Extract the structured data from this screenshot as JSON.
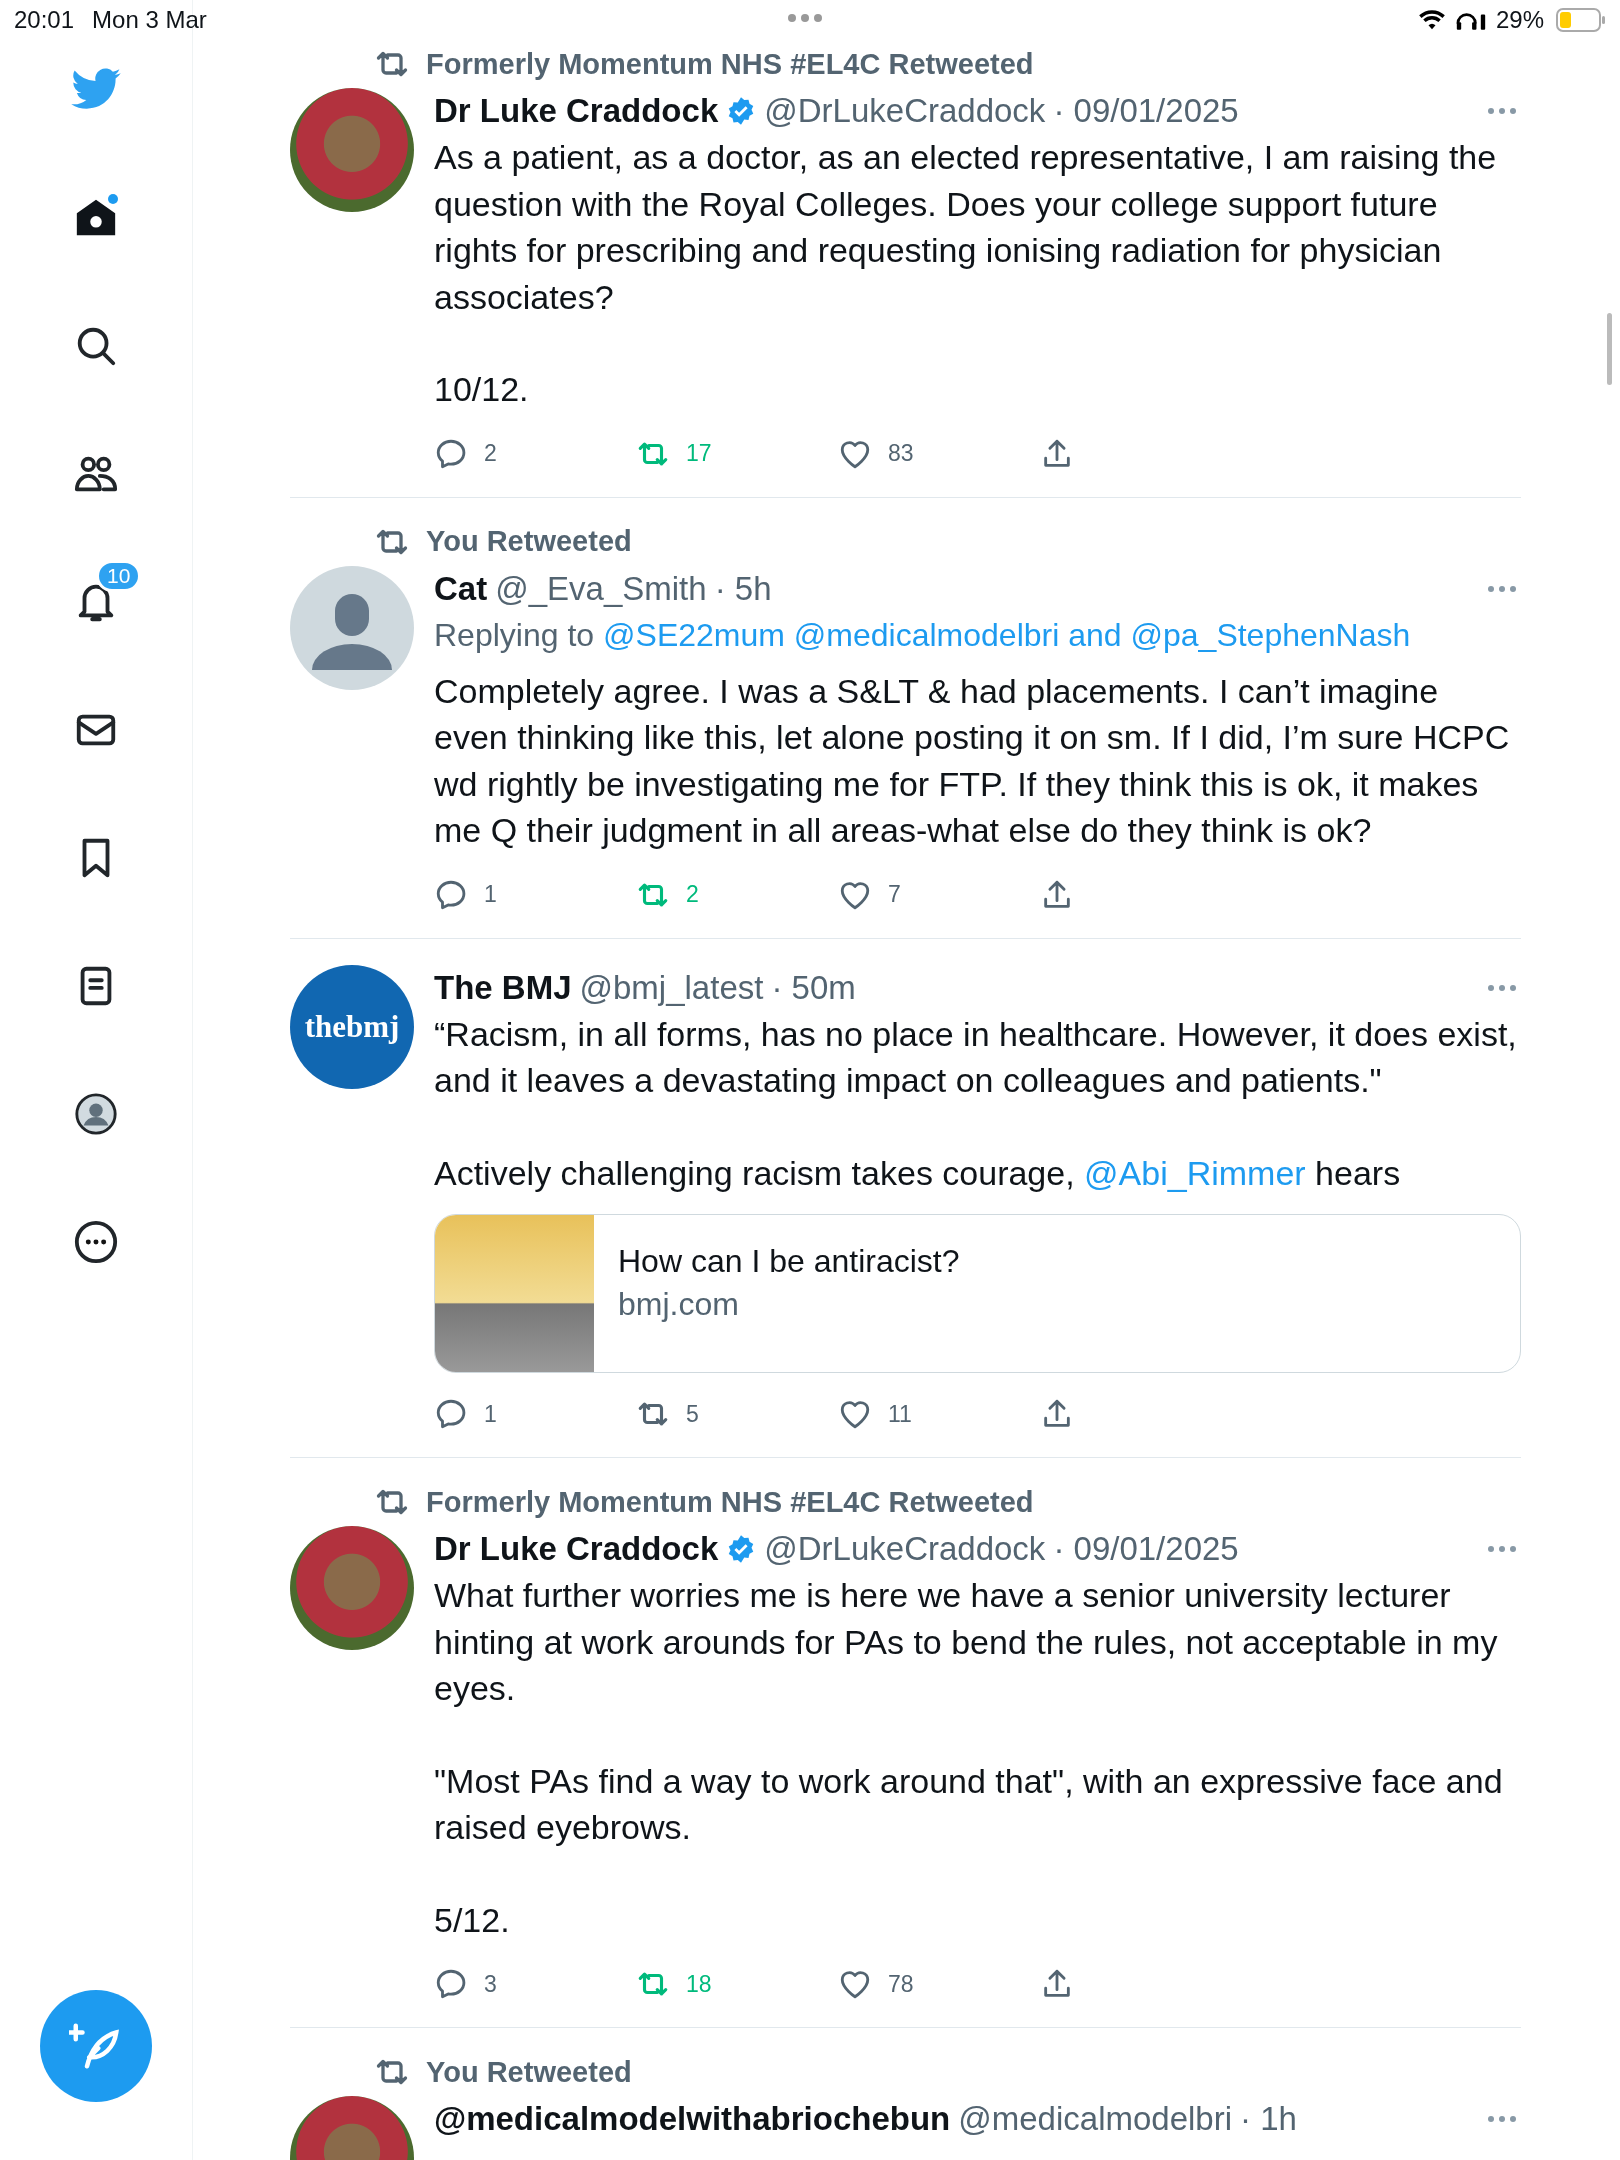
{
  "status_bar": {
    "time": "20:01",
    "date": "Mon 3 Mar",
    "battery": "29%"
  },
  "sidebar": {
    "items": [
      {
        "kind": "logo"
      },
      {
        "kind": "home",
        "selected": true,
        "dot": true
      },
      {
        "kind": "search",
        "selected": false
      },
      {
        "kind": "communities",
        "selected": false
      },
      {
        "kind": "notifications",
        "selected": false,
        "badge": "10"
      },
      {
        "kind": "messages",
        "selected": false
      },
      {
        "kind": "bookmarks",
        "selected": false
      },
      {
        "kind": "lists",
        "selected": false
      },
      {
        "kind": "profile",
        "selected": false
      },
      {
        "kind": "more",
        "selected": false
      }
    ]
  },
  "tweets": [
    {
      "retweeted_by": "Formerly Momentum NHS #EL4C Retweeted",
      "avatar": {
        "kind": "photo"
      },
      "name": "Dr Luke Craddock",
      "verified": true,
      "handle": "@DrLukeCraddock",
      "time": "· 09/01/2025",
      "paragraphs": [
        [
          {
            "kind": "text",
            "text": "As a patient, as a doctor, as an elected representative, I am raising the question with the Royal Colleges. Does your college support future rights for prescribing and requesting ionising radiation for physician associates?"
          }
        ],
        [
          {
            "kind": "text",
            "text": "10/12."
          }
        ]
      ],
      "actions": {
        "replies": "2",
        "retweets": "17",
        "retweeted": true,
        "likes": "83",
        "liked": false
      }
    },
    {
      "retweeted_by": "You Retweeted",
      "avatar": {
        "kind": "default"
      },
      "name": "Cat",
      "verified": false,
      "handle": "@_Eva_Smith",
      "time": "· 5h",
      "replying_to": {
        "prefix": "Replying to",
        "users": "@SE22mum @medicalmodelbri and @pa_StephenNash"
      },
      "paragraphs": [
        [
          {
            "kind": "text",
            "text": "Completely agree. I was a S&LT & had placements. I can’t imagine even thinking like this, let alone posting it on sm. If I did, I’m sure HCPC wd rightly be investigating me for FTP. If they think this is ok, it makes me Q their judgment in all areas-what else do they think is ok?"
          }
        ]
      ],
      "actions": {
        "replies": "1",
        "retweets": "2",
        "retweeted": true,
        "likes": "7",
        "liked": false
      }
    },
    {
      "avatar": {
        "kind": "logo"
      },
      "avatar_text": "thebmj",
      "name": "The BMJ",
      "verified": false,
      "handle": "@bmj_latest",
      "time": "· 50m",
      "paragraphs": [
        [
          {
            "kind": "text",
            "text": "“Racism, in all forms, has no place in healthcare. However, it does exist, and it leaves a devastating impact on colleagues and patients.\""
          }
        ],
        [
          {
            "kind": "text",
            "text": "Actively challenging racism takes courage, "
          },
          {
            "kind": "mention",
            "text": "@Abi_Rimmer"
          },
          {
            "kind": "text",
            "text": " hears"
          }
        ]
      ],
      "card": {
        "title": "How can I be antiracist?",
        "domain": "bmj.com"
      },
      "actions": {
        "replies": "1",
        "retweets": "5",
        "retweeted": false,
        "likes": "11",
        "liked": false
      }
    },
    {
      "retweeted_by": "Formerly Momentum NHS #EL4C Retweeted",
      "avatar": {
        "kind": "photo"
      },
      "name": "Dr Luke Craddock",
      "verified": true,
      "handle": "@DrLukeCraddock",
      "time": "· 09/01/2025",
      "paragraphs": [
        [
          {
            "kind": "text",
            "text": "What further worries me is here we have a senior university lecturer hinting at work arounds for PAs to bend the rules, not acceptable in my eyes."
          }
        ],
        [
          {
            "kind": "text",
            "text": "\"Most PAs find a way to work around that\", with an expressive face and raised eyebrows."
          }
        ],
        [
          {
            "kind": "text",
            "text": "5/12."
          }
        ]
      ],
      "actions": {
        "replies": "3",
        "retweets": "18",
        "retweeted": true,
        "likes": "78",
        "liked": false
      }
    },
    {
      "retweeted_by": "You Retweeted",
      "avatar": {
        "kind": "photo"
      },
      "name": "@medicalmodelwithabriochebun",
      "verified": false,
      "handle": "@medicalmodelbri",
      "time": "· 1h"
    }
  ]
}
